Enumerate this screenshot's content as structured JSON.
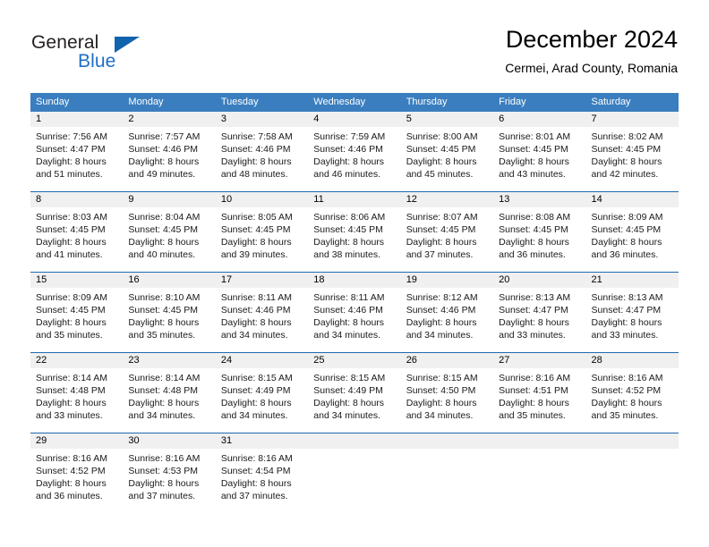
{
  "brand": {
    "name_top": "General",
    "name_bottom": "Blue",
    "color_top": "#231f20",
    "color_bottom": "#1f6fc4",
    "triangle_color": "#1263ae"
  },
  "header": {
    "title": "December 2024",
    "subtitle": "Cermei, Arad County, Romania"
  },
  "theme": {
    "header_bg": "#3a7ebf",
    "header_text": "#ffffff",
    "week_separator": "#1f6aae",
    "daynum_band": "#f0f0f0"
  },
  "weekdays": [
    "Sunday",
    "Monday",
    "Tuesday",
    "Wednesday",
    "Thursday",
    "Friday",
    "Saturday"
  ],
  "weeks": [
    {
      "days": [
        {
          "num": "1",
          "sunrise": "Sunrise: 7:56 AM",
          "sunset": "Sunset: 4:47 PM",
          "daylight1": "Daylight: 8 hours",
          "daylight2": "and 51 minutes."
        },
        {
          "num": "2",
          "sunrise": "Sunrise: 7:57 AM",
          "sunset": "Sunset: 4:46 PM",
          "daylight1": "Daylight: 8 hours",
          "daylight2": "and 49 minutes."
        },
        {
          "num": "3",
          "sunrise": "Sunrise: 7:58 AM",
          "sunset": "Sunset: 4:46 PM",
          "daylight1": "Daylight: 8 hours",
          "daylight2": "and 48 minutes."
        },
        {
          "num": "4",
          "sunrise": "Sunrise: 7:59 AM",
          "sunset": "Sunset: 4:46 PM",
          "daylight1": "Daylight: 8 hours",
          "daylight2": "and 46 minutes."
        },
        {
          "num": "5",
          "sunrise": "Sunrise: 8:00 AM",
          "sunset": "Sunset: 4:45 PM",
          "daylight1": "Daylight: 8 hours",
          "daylight2": "and 45 minutes."
        },
        {
          "num": "6",
          "sunrise": "Sunrise: 8:01 AM",
          "sunset": "Sunset: 4:45 PM",
          "daylight1": "Daylight: 8 hours",
          "daylight2": "and 43 minutes."
        },
        {
          "num": "7",
          "sunrise": "Sunrise: 8:02 AM",
          "sunset": "Sunset: 4:45 PM",
          "daylight1": "Daylight: 8 hours",
          "daylight2": "and 42 minutes."
        }
      ]
    },
    {
      "days": [
        {
          "num": "8",
          "sunrise": "Sunrise: 8:03 AM",
          "sunset": "Sunset: 4:45 PM",
          "daylight1": "Daylight: 8 hours",
          "daylight2": "and 41 minutes."
        },
        {
          "num": "9",
          "sunrise": "Sunrise: 8:04 AM",
          "sunset": "Sunset: 4:45 PM",
          "daylight1": "Daylight: 8 hours",
          "daylight2": "and 40 minutes."
        },
        {
          "num": "10",
          "sunrise": "Sunrise: 8:05 AM",
          "sunset": "Sunset: 4:45 PM",
          "daylight1": "Daylight: 8 hours",
          "daylight2": "and 39 minutes."
        },
        {
          "num": "11",
          "sunrise": "Sunrise: 8:06 AM",
          "sunset": "Sunset: 4:45 PM",
          "daylight1": "Daylight: 8 hours",
          "daylight2": "and 38 minutes."
        },
        {
          "num": "12",
          "sunrise": "Sunrise: 8:07 AM",
          "sunset": "Sunset: 4:45 PM",
          "daylight1": "Daylight: 8 hours",
          "daylight2": "and 37 minutes."
        },
        {
          "num": "13",
          "sunrise": "Sunrise: 8:08 AM",
          "sunset": "Sunset: 4:45 PM",
          "daylight1": "Daylight: 8 hours",
          "daylight2": "and 36 minutes."
        },
        {
          "num": "14",
          "sunrise": "Sunrise: 8:09 AM",
          "sunset": "Sunset: 4:45 PM",
          "daylight1": "Daylight: 8 hours",
          "daylight2": "and 36 minutes."
        }
      ]
    },
    {
      "days": [
        {
          "num": "15",
          "sunrise": "Sunrise: 8:09 AM",
          "sunset": "Sunset: 4:45 PM",
          "daylight1": "Daylight: 8 hours",
          "daylight2": "and 35 minutes."
        },
        {
          "num": "16",
          "sunrise": "Sunrise: 8:10 AM",
          "sunset": "Sunset: 4:45 PM",
          "daylight1": "Daylight: 8 hours",
          "daylight2": "and 35 minutes."
        },
        {
          "num": "17",
          "sunrise": "Sunrise: 8:11 AM",
          "sunset": "Sunset: 4:46 PM",
          "daylight1": "Daylight: 8 hours",
          "daylight2": "and 34 minutes."
        },
        {
          "num": "18",
          "sunrise": "Sunrise: 8:11 AM",
          "sunset": "Sunset: 4:46 PM",
          "daylight1": "Daylight: 8 hours",
          "daylight2": "and 34 minutes."
        },
        {
          "num": "19",
          "sunrise": "Sunrise: 8:12 AM",
          "sunset": "Sunset: 4:46 PM",
          "daylight1": "Daylight: 8 hours",
          "daylight2": "and 34 minutes."
        },
        {
          "num": "20",
          "sunrise": "Sunrise: 8:13 AM",
          "sunset": "Sunset: 4:47 PM",
          "daylight1": "Daylight: 8 hours",
          "daylight2": "and 33 minutes."
        },
        {
          "num": "21",
          "sunrise": "Sunrise: 8:13 AM",
          "sunset": "Sunset: 4:47 PM",
          "daylight1": "Daylight: 8 hours",
          "daylight2": "and 33 minutes."
        }
      ]
    },
    {
      "days": [
        {
          "num": "22",
          "sunrise": "Sunrise: 8:14 AM",
          "sunset": "Sunset: 4:48 PM",
          "daylight1": "Daylight: 8 hours",
          "daylight2": "and 33 minutes."
        },
        {
          "num": "23",
          "sunrise": "Sunrise: 8:14 AM",
          "sunset": "Sunset: 4:48 PM",
          "daylight1": "Daylight: 8 hours",
          "daylight2": "and 34 minutes."
        },
        {
          "num": "24",
          "sunrise": "Sunrise: 8:15 AM",
          "sunset": "Sunset: 4:49 PM",
          "daylight1": "Daylight: 8 hours",
          "daylight2": "and 34 minutes."
        },
        {
          "num": "25",
          "sunrise": "Sunrise: 8:15 AM",
          "sunset": "Sunset: 4:49 PM",
          "daylight1": "Daylight: 8 hours",
          "daylight2": "and 34 minutes."
        },
        {
          "num": "26",
          "sunrise": "Sunrise: 8:15 AM",
          "sunset": "Sunset: 4:50 PM",
          "daylight1": "Daylight: 8 hours",
          "daylight2": "and 34 minutes."
        },
        {
          "num": "27",
          "sunrise": "Sunrise: 8:16 AM",
          "sunset": "Sunset: 4:51 PM",
          "daylight1": "Daylight: 8 hours",
          "daylight2": "and 35 minutes."
        },
        {
          "num": "28",
          "sunrise": "Sunrise: 8:16 AM",
          "sunset": "Sunset: 4:52 PM",
          "daylight1": "Daylight: 8 hours",
          "daylight2": "and 35 minutes."
        }
      ]
    },
    {
      "days": [
        {
          "num": "29",
          "sunrise": "Sunrise: 8:16 AM",
          "sunset": "Sunset: 4:52 PM",
          "daylight1": "Daylight: 8 hours",
          "daylight2": "and 36 minutes."
        },
        {
          "num": "30",
          "sunrise": "Sunrise: 8:16 AM",
          "sunset": "Sunset: 4:53 PM",
          "daylight1": "Daylight: 8 hours",
          "daylight2": "and 37 minutes."
        },
        {
          "num": "31",
          "sunrise": "Sunrise: 8:16 AM",
          "sunset": "Sunset: 4:54 PM",
          "daylight1": "Daylight: 8 hours",
          "daylight2": "and 37 minutes."
        },
        {
          "num": "",
          "sunrise": "",
          "sunset": "",
          "daylight1": "",
          "daylight2": ""
        },
        {
          "num": "",
          "sunrise": "",
          "sunset": "",
          "daylight1": "",
          "daylight2": ""
        },
        {
          "num": "",
          "sunrise": "",
          "sunset": "",
          "daylight1": "",
          "daylight2": ""
        },
        {
          "num": "",
          "sunrise": "",
          "sunset": "",
          "daylight1": "",
          "daylight2": ""
        }
      ]
    }
  ]
}
